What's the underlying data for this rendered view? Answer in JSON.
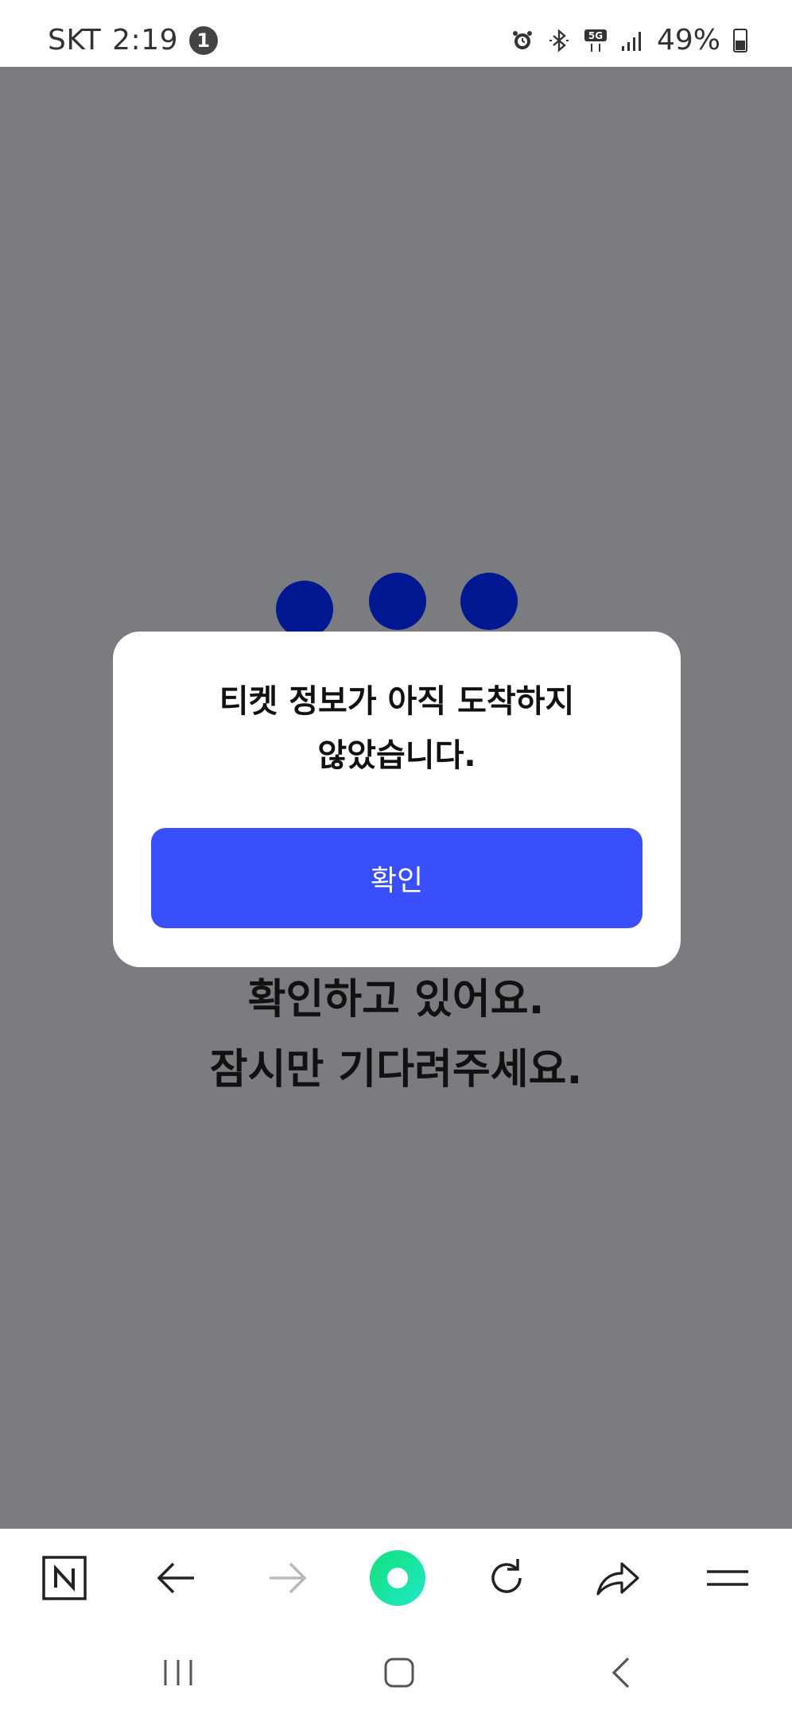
{
  "status_bar": {
    "carrier": "SKT",
    "time": "2:19",
    "notification_count": "1",
    "battery": "49%",
    "network": "5G",
    "icons": [
      "alarm-icon",
      "bluetooth-icon",
      "5g-icon",
      "signal-icon",
      "battery-icon"
    ]
  },
  "loading": {
    "line1": "확인하고 있어요.",
    "line2": "잠시만 기다려주세요."
  },
  "dialog": {
    "message_line1": "티켓 정보가 아직 도착하지",
    "message_line2": "않았습니다.",
    "confirm_label": "확인"
  },
  "toolbar": {
    "items": [
      "naver-home-icon",
      "back-arrow-icon",
      "forward-arrow-icon",
      "green-dot-icon",
      "refresh-icon",
      "share-icon",
      "menu-icon"
    ]
  },
  "system_nav": {
    "items": [
      "recent-apps-icon",
      "home-icon",
      "back-icon"
    ]
  },
  "colors": {
    "overlay": "#7b7c7f",
    "dots": "#021893",
    "button": "#3a4ffc",
    "accent_green": "#19e58a"
  }
}
